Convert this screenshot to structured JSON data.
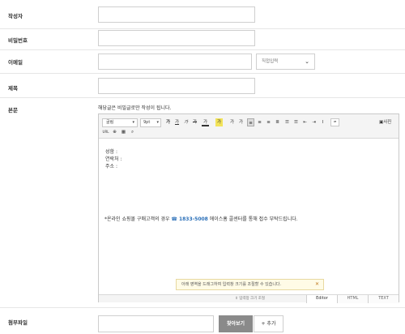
{
  "form": {
    "author_label": "작성자",
    "author_value": "",
    "password_label": "비밀번호",
    "password_value": "",
    "email_label": "이메일",
    "email_value": "",
    "email_domain_select": "직접입력",
    "title_label": "제목",
    "title_value": "",
    "body_label": "본문",
    "notice": "해당글은 비밀글로만 작성이 됩니다.",
    "attachment_label": "첨부파일",
    "attachment_value": "",
    "find_button": "찾아보기",
    "add_button": "+ 추가"
  },
  "editor": {
    "toolbar": {
      "font_select": "굴림",
      "size_select": "9pt",
      "bold": "가",
      "underline": "가",
      "italic": "가",
      "strike": "가",
      "font_color": "가",
      "bg_color": "가",
      "superscript": "가",
      "subscript": "가",
      "quote": "“",
      "photo": "사진",
      "url": "URL"
    },
    "content": {
      "line1": "성함 :",
      "line2": "연락처 :",
      "line3": "주소 :",
      "footer_prefix": "*온라인 쇼핑몰 구매고객의 경우 ",
      "footer_phone": "☎ 1833-5008",
      "footer_suffix": " 에이스홈 콜센터를 통해 접수 부탁드립니다."
    },
    "tooltip": "아래 영역을 드래그하여 입력창 크기를 조절할 수 있습니다.",
    "resize_label": "⇕ 입력창 크기 조절",
    "modes": [
      "Editor",
      "HTML",
      "TEXT"
    ]
  }
}
